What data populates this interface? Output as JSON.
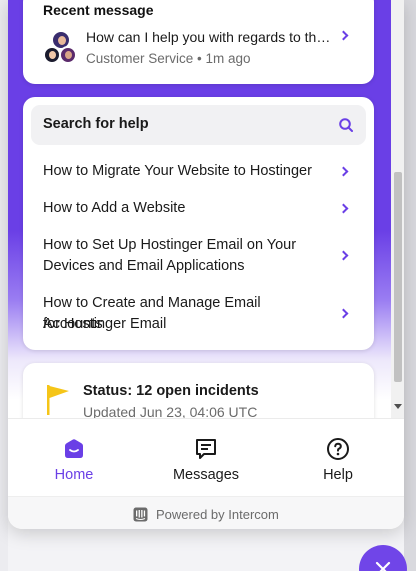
{
  "recent": {
    "title": "Recent message",
    "message": "How can I help you with regards to the…",
    "meta": "Customer Service • 1m ago"
  },
  "help": {
    "search_label": "Search for help",
    "articles": [
      {
        "line1": "How to Migrate Your Website to Hostinger",
        "line2": ""
      },
      {
        "line1": "How to Add a Website",
        "line2": ""
      },
      {
        "line1": "How to Set Up Hostinger Email on Your",
        "line2": "Devices and Email Applications"
      },
      {
        "line1": "How to Create and Manage Email Accounts",
        "line2": "for Hostinger Email"
      }
    ]
  },
  "status": {
    "title": "Status: 12 open incidents",
    "updated": "Updated Jun 23, 04:06 UTC",
    "flag_color": "#f5c518"
  },
  "nav": {
    "home": "Home",
    "messages": "Messages",
    "help": "Help",
    "active": "home",
    "accent": "#6a3fe6"
  },
  "footer": {
    "powered": "Powered by Intercom"
  },
  "icons": {
    "search": "search-icon",
    "chevron": "chevron-right-icon",
    "flag": "flag-icon",
    "home": "home-icon",
    "messages": "messages-icon",
    "help": "help-icon",
    "intercom": "intercom-logo-icon",
    "close": "close-icon"
  }
}
